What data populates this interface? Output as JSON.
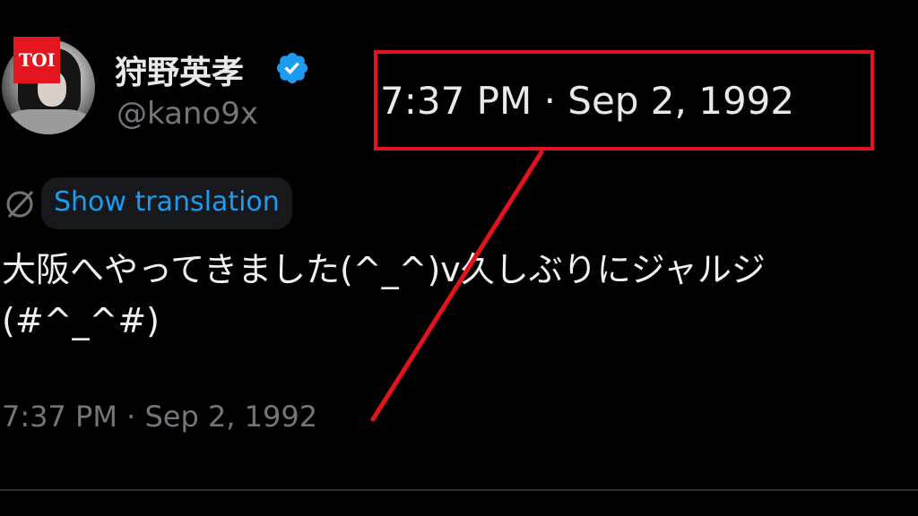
{
  "brand": {
    "logo_text": "TOI",
    "logo_color": "#e3161f"
  },
  "tweet": {
    "author": {
      "display_name": "狩野英孝",
      "handle": "@kano9x",
      "verified": true,
      "verified_icon": "verified-badge-icon"
    },
    "translate": {
      "icon": "translate-icon",
      "label": "Show translation"
    },
    "text_lines": [
      "大阪へやってきました(^_^)v久しぶりにジャルジ",
      "(#^_^#)"
    ],
    "timestamp": "7:37 PM · Sep 2, 1992"
  },
  "annotation": {
    "highlight_text": "7:37 PM · Sep 2, 1992",
    "color": "#e3121c"
  },
  "colors": {
    "background": "#000000",
    "text_primary": "#e7e9ea",
    "text_secondary": "#71767b",
    "link": "#1d9bf0"
  }
}
